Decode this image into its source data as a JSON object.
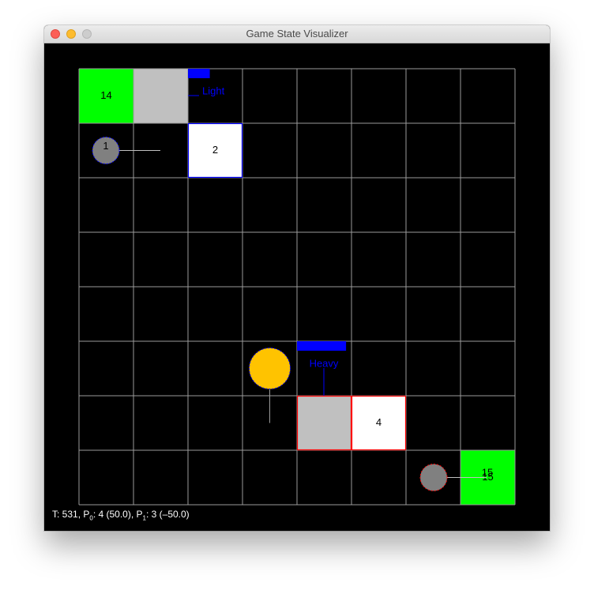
{
  "window": {
    "title": "Game State Visualizer"
  },
  "colors": {
    "background": "#000000",
    "grid": "#9a9a9a",
    "goal": "#00ff00",
    "block_gray": "#c0c0c0",
    "block_white": "#ffffff",
    "player0": "#0000ff",
    "player1": "#ff0000",
    "robot": "#808080",
    "ball": "#ffc300"
  },
  "board": {
    "columns": 8,
    "rows": 8,
    "cells": [
      {
        "id": "goal-14",
        "col": 0,
        "row": 0,
        "kind": "goal",
        "label": "14",
        "outline": "none"
      },
      {
        "id": "block-light",
        "col": 1,
        "row": 0,
        "kind": "gray",
        "label": "",
        "outline": "none"
      },
      {
        "id": "block-2",
        "col": 2,
        "row": 1,
        "kind": "white",
        "label": "2",
        "outline": "player0"
      },
      {
        "id": "block-heavy",
        "col": 4,
        "row": 6,
        "kind": "gray",
        "label": "",
        "outline": "player1"
      },
      {
        "id": "block-4",
        "col": 5,
        "row": 6,
        "kind": "white",
        "label": "4",
        "outline": "player1"
      },
      {
        "id": "goal-15",
        "col": 7,
        "row": 7,
        "kind": "goal",
        "label": "15",
        "outline": "none"
      }
    ],
    "robots": [
      {
        "id": "robot-1",
        "col": 0,
        "row": 1,
        "label": "1",
        "team": "player0",
        "fill": "robot"
      },
      {
        "id": "robot-15",
        "col": 6,
        "row": 7,
        "label": "",
        "team": "player1",
        "fill": "robot"
      },
      {
        "id": "ball",
        "col": 3,
        "row": 5,
        "label": "",
        "team": "player0",
        "fill": "ball"
      }
    ],
    "bars": [
      {
        "id": "bar-light",
        "label": "Light",
        "level": 0.4
      },
      {
        "id": "bar-heavy",
        "label": "Heavy",
        "level": 0.9
      }
    ]
  },
  "status": {
    "prefix": "T: 531, P",
    "p0_sub": "0",
    "p0_text": ": 4 (50.0), P",
    "p1_sub": "1",
    "p1_text": ": 3 (–50.0)"
  }
}
